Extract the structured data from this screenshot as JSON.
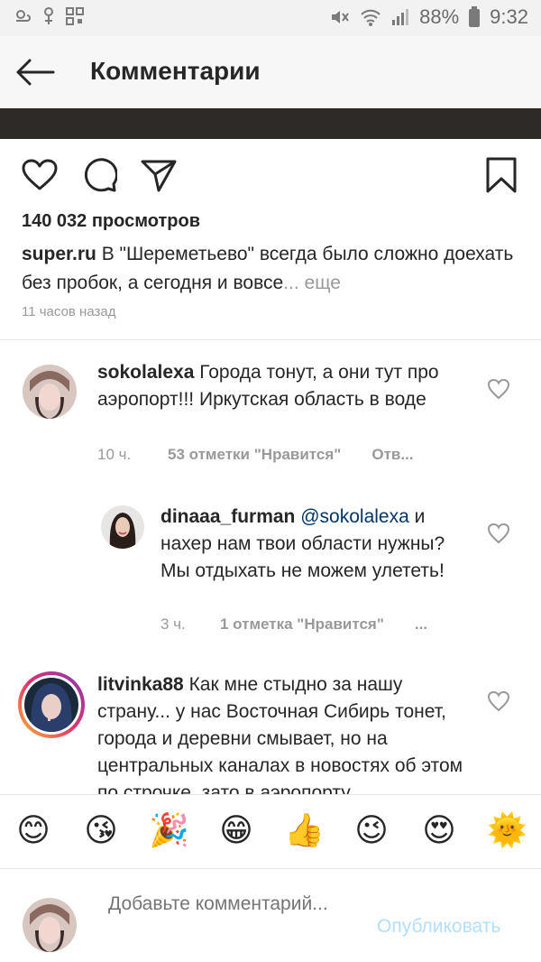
{
  "status_bar": {
    "battery": "88%",
    "time": "9:32"
  },
  "header": {
    "title": "Комментарии"
  },
  "post": {
    "views": "140 032 просмотров",
    "caption_user": "super.ru",
    "caption_text": " В \"Шереметьево\" всегда было сложно доехать без пробок, а сегодня и вовсе",
    "caption_more": "... еще",
    "time_ago": "11 часов назад"
  },
  "comments": [
    {
      "user": "sokolalexa",
      "text": " Города тонут, а они тут про аэропорт!!! Иркутская область в воде",
      "time": "10 ч.",
      "likes": "53 отметки \"Нравится\"",
      "reply": "Отв..."
    },
    {
      "user": "dinaaa_furman",
      "mention": "@sokolalexa",
      "text": "и нахер нам твои области нужны? Мы отдыхать не можем улететь!",
      "time": "3 ч.",
      "likes": "1 отметка \"Нравится\"",
      "more": "..."
    },
    {
      "user": "litvinka88",
      "text": " Как мне стыдно за нашу страну... у нас Восточная Сибирь тонет, города и деревни смывает, но на центральных каналах в новостях об этом по строчке, зато в аэропорту"
    }
  ],
  "emoji_bar": [
    "😊",
    "😘",
    "🎉",
    "😁",
    "👍",
    "😉",
    "😍",
    "🌞"
  ],
  "input": {
    "placeholder": "Добавьте комментарий...",
    "publish": "Опубликовать"
  },
  "colors": {
    "link": "#003569",
    "muted": "#999999",
    "publish_disabled": "#b2dffc"
  }
}
